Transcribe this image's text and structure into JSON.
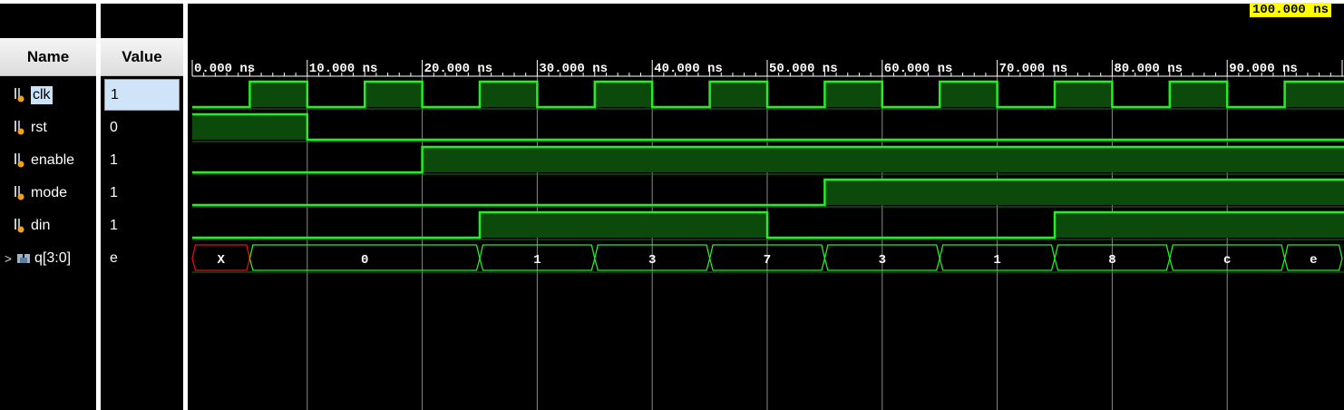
{
  "headers": {
    "name": "Name",
    "value": "Value"
  },
  "cursor_time": "100.000 ns",
  "time_unit": "ns",
  "ruler": {
    "max_ns": 100,
    "labels": [
      "0.000 ns",
      "10.000 ns",
      "20.000 ns",
      "30.000 ns",
      "40.000 ns",
      "50.000 ns",
      "60.000 ns",
      "70.000 ns",
      "80.000 ns",
      "90.000 ns"
    ]
  },
  "signals": [
    {
      "name": "clk",
      "value": "1",
      "kind": "bit",
      "selected": true,
      "transitions": [
        [
          0,
          0
        ],
        [
          5,
          1
        ],
        [
          10,
          0
        ],
        [
          15,
          1
        ],
        [
          20,
          0
        ],
        [
          25,
          1
        ],
        [
          30,
          0
        ],
        [
          35,
          1
        ],
        [
          40,
          0
        ],
        [
          45,
          1
        ],
        [
          50,
          0
        ],
        [
          55,
          1
        ],
        [
          60,
          0
        ],
        [
          65,
          1
        ],
        [
          70,
          0
        ],
        [
          75,
          1
        ],
        [
          80,
          0
        ],
        [
          85,
          1
        ],
        [
          90,
          0
        ],
        [
          95,
          1
        ]
      ]
    },
    {
      "name": "rst",
      "value": "0",
      "kind": "bit",
      "transitions": [
        [
          0,
          1
        ],
        [
          10,
          0
        ]
      ]
    },
    {
      "name": "enable",
      "value": "1",
      "kind": "bit",
      "transitions": [
        [
          0,
          0
        ],
        [
          20,
          1
        ]
      ]
    },
    {
      "name": "mode",
      "value": "1",
      "kind": "bit",
      "transitions": [
        [
          0,
          0
        ],
        [
          55,
          1
        ]
      ]
    },
    {
      "name": "din",
      "value": "1",
      "kind": "bit",
      "transitions": [
        [
          0,
          0
        ],
        [
          25,
          1
        ],
        [
          50,
          0
        ],
        [
          75,
          1
        ]
      ]
    },
    {
      "name": "q[3:0]",
      "value": "e",
      "kind": "bus",
      "expander": ">",
      "segments": [
        {
          "start": 0,
          "end": 5,
          "label": "X",
          "unknown": true
        },
        {
          "start": 5,
          "end": 25,
          "label": "0"
        },
        {
          "start": 25,
          "end": 35,
          "label": "1"
        },
        {
          "start": 35,
          "end": 45,
          "label": "3"
        },
        {
          "start": 45,
          "end": 55,
          "label": "7"
        },
        {
          "start": 55,
          "end": 65,
          "label": "3"
        },
        {
          "start": 65,
          "end": 75,
          "label": "1"
        },
        {
          "start": 75,
          "end": 85,
          "label": "8"
        },
        {
          "start": 85,
          "end": 95,
          "label": "c"
        },
        {
          "start": 95,
          "end": 100,
          "label": "e"
        }
      ]
    }
  ],
  "colors": {
    "wave": "#22ee22",
    "wave_fill": "#0c4a0c",
    "unknown": "#e01010",
    "grid": "#8a8a8a",
    "cursor_bg": "#ffff00"
  }
}
